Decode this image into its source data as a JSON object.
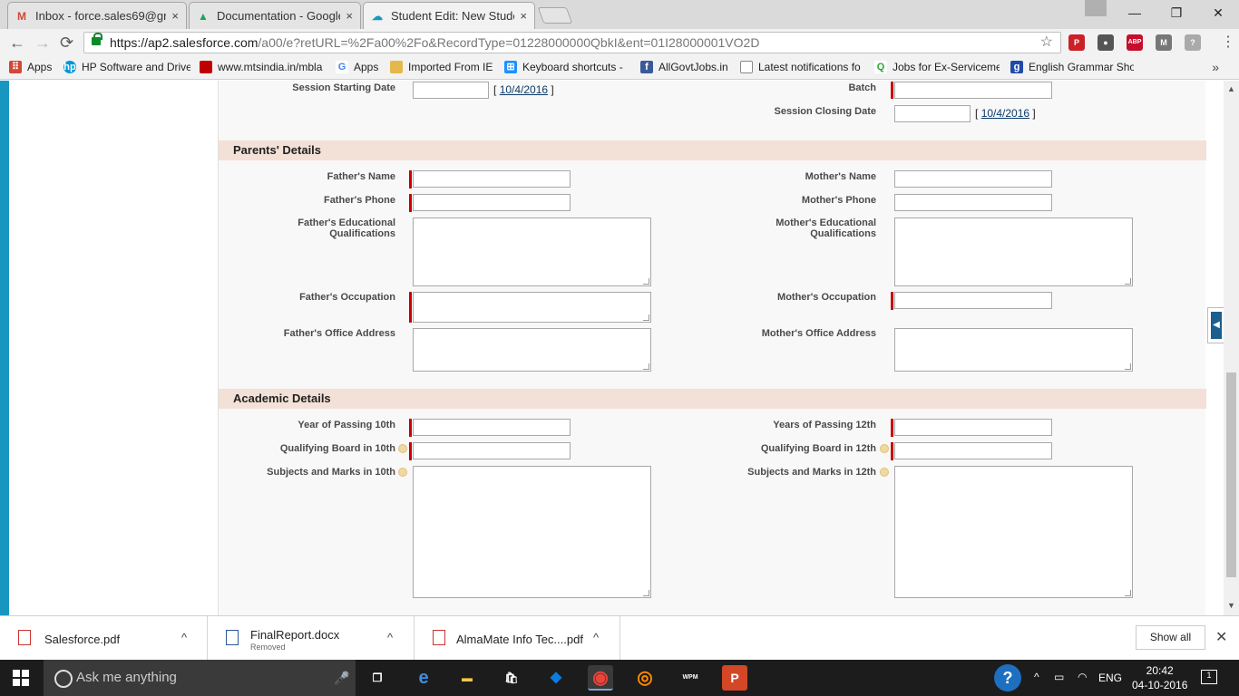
{
  "browser": {
    "tabs": [
      {
        "title": "Inbox - force.sales69@gr",
        "icon": "gmail-icon",
        "color": "#d14836"
      },
      {
        "title": "Documentation - Google",
        "icon": "drive-icon",
        "color": "#1fa463"
      },
      {
        "title": "Student Edit: New Studen",
        "icon": "salesforce-icon",
        "color": "#1798c1"
      }
    ],
    "close_glyph": "×",
    "window_controls": {
      "minimize": "—",
      "maximize": "❐",
      "close": "✕"
    },
    "nav": {
      "back": "←",
      "forward": "→",
      "reload": "⟳"
    },
    "url_host": "https://ap2.salesforce.com",
    "url_path": "/a00/e?retURL=%2Fa00%2Fo&RecordType=01228000000QbkI&ent=01I28000001VO2D",
    "star": "☆",
    "extensions": [
      {
        "name": "pinterest-icon",
        "label": "P",
        "color": "#cb2027"
      },
      {
        "name": "video-extension-icon",
        "label": "●",
        "color": "#555555"
      },
      {
        "name": "adblock-plus-icon",
        "label": "ABP",
        "color": "#c70d2c"
      },
      {
        "name": "extension-m-icon",
        "label": "M",
        "color": "#777777"
      },
      {
        "name": "extension-person-icon",
        "label": "?",
        "color": "#aaaaaa"
      }
    ],
    "menu": "⋮",
    "bookmarks": [
      {
        "label": "Apps",
        "icon": "apps-grid-icon",
        "color": "#d14836"
      },
      {
        "label": "HP Software and Drive",
        "icon": "hp-icon",
        "color": "#0096d6"
      },
      {
        "label": "www.mtsindia.in/mbla",
        "icon": "mts-icon",
        "color": "#c00000"
      },
      {
        "label": "Apps",
        "icon": "google-icon",
        "color": "#4285f4"
      },
      {
        "label": "Imported From IE",
        "icon": "folder-icon",
        "color": "#e6b84b"
      },
      {
        "label": "Keyboard shortcuts -",
        "icon": "windows-icon",
        "color": "#1e90ff"
      },
      {
        "label": "AllGovtJobs.in",
        "icon": "facebook-icon",
        "color": "#3b5998"
      },
      {
        "label": "Latest notifications fo",
        "icon": "page-icon",
        "color": "#888888"
      },
      {
        "label": "Jobs for Ex-Serviceme",
        "icon": "q-icon",
        "color": "#2aa837"
      },
      {
        "label": "English Grammar Sho",
        "icon": "grammar-icon",
        "color": "#1f4aa8"
      }
    ],
    "bookmarks_more": "»"
  },
  "form": {
    "top_fields": {
      "session_starting_label": "Session Starting Date",
      "session_starting_date": "10/4/2016",
      "batch_label": "Batch",
      "session_closing_label": "Session Closing Date",
      "session_closing_date": "10/4/2016",
      "bracket_open": "[",
      "bracket_close": "]"
    },
    "parents": {
      "header": "Parents' Details",
      "fathers_name": "Father's Name",
      "mothers_name": "Mother's Name",
      "fathers_phone": "Father's Phone",
      "mothers_phone": "Mother's Phone",
      "fathers_edu_1": "Father's Educational",
      "fathers_edu_2": "Qualifications",
      "mothers_edu_1": "Mother's Educational",
      "mothers_edu_2": "Qualifications",
      "fathers_occupation": "Father's Occupation",
      "mothers_occupation": "Mother's Occupation",
      "fathers_office": "Father's Office Address",
      "mothers_office": "Mother's Office Address"
    },
    "academic": {
      "header": "Academic Details",
      "year_10": "Year of Passing 10th",
      "year_12": "Years of Passing 12th",
      "board_10": "Qualifying Board in 10th",
      "board_12": "Qualifying Board in 12th",
      "subjects_10": "Subjects and Marks in 10th",
      "subjects_12": "Subjects and Marks in 12th"
    },
    "sidetab_glyph": "◀"
  },
  "downloads": {
    "items": [
      {
        "name": "Salesforce.pdf",
        "sub": ""
      },
      {
        "name": "FinalReport.docx",
        "sub": "Removed"
      },
      {
        "name": "AlmaMate Info Tec....pdf",
        "sub": ""
      }
    ],
    "chevron": "^",
    "show_all": "Show all",
    "close": "✕"
  },
  "taskbar": {
    "search_placeholder": "Ask me anything",
    "mic": "🎤",
    "apps": [
      {
        "name": "task-view-icon",
        "label": "❐",
        "color": "#ffffff",
        "bg": "#1c1c1c"
      },
      {
        "name": "edge-icon",
        "label": "e",
        "color": "#3c8fe0",
        "bg": "#1c1c1c"
      },
      {
        "name": "file-explorer-icon",
        "label": "▬",
        "color": "#f3c54a",
        "bg": "#1c1c1c"
      },
      {
        "name": "store-icon",
        "label": "🛍",
        "color": "#ffffff",
        "bg": "#1c1c1c"
      },
      {
        "name": "dropbox-icon",
        "label": "◆",
        "color": "#0d7ce0",
        "bg": "#1c1c1c"
      },
      {
        "name": "chrome-icon",
        "label": "◉",
        "color": "#e8453c",
        "bg": "#1c1c1c"
      },
      {
        "name": "firefox-icon",
        "label": "◎",
        "color": "#ff8a00",
        "bg": "#1c1c1c"
      },
      {
        "name": "wpm-icon",
        "label": "WPM",
        "color": "#ffffff",
        "bg": "#1c1c1c"
      },
      {
        "name": "powerpoint-icon",
        "label": "P",
        "color": "#ffffff",
        "bg": "#d24726"
      }
    ],
    "help": "?",
    "tray": {
      "chevron": "^",
      "battery": "▭",
      "wifi": "◠",
      "lang": "ENG"
    },
    "time": "20:42",
    "date": "04-10-2016",
    "notifications": "1"
  }
}
